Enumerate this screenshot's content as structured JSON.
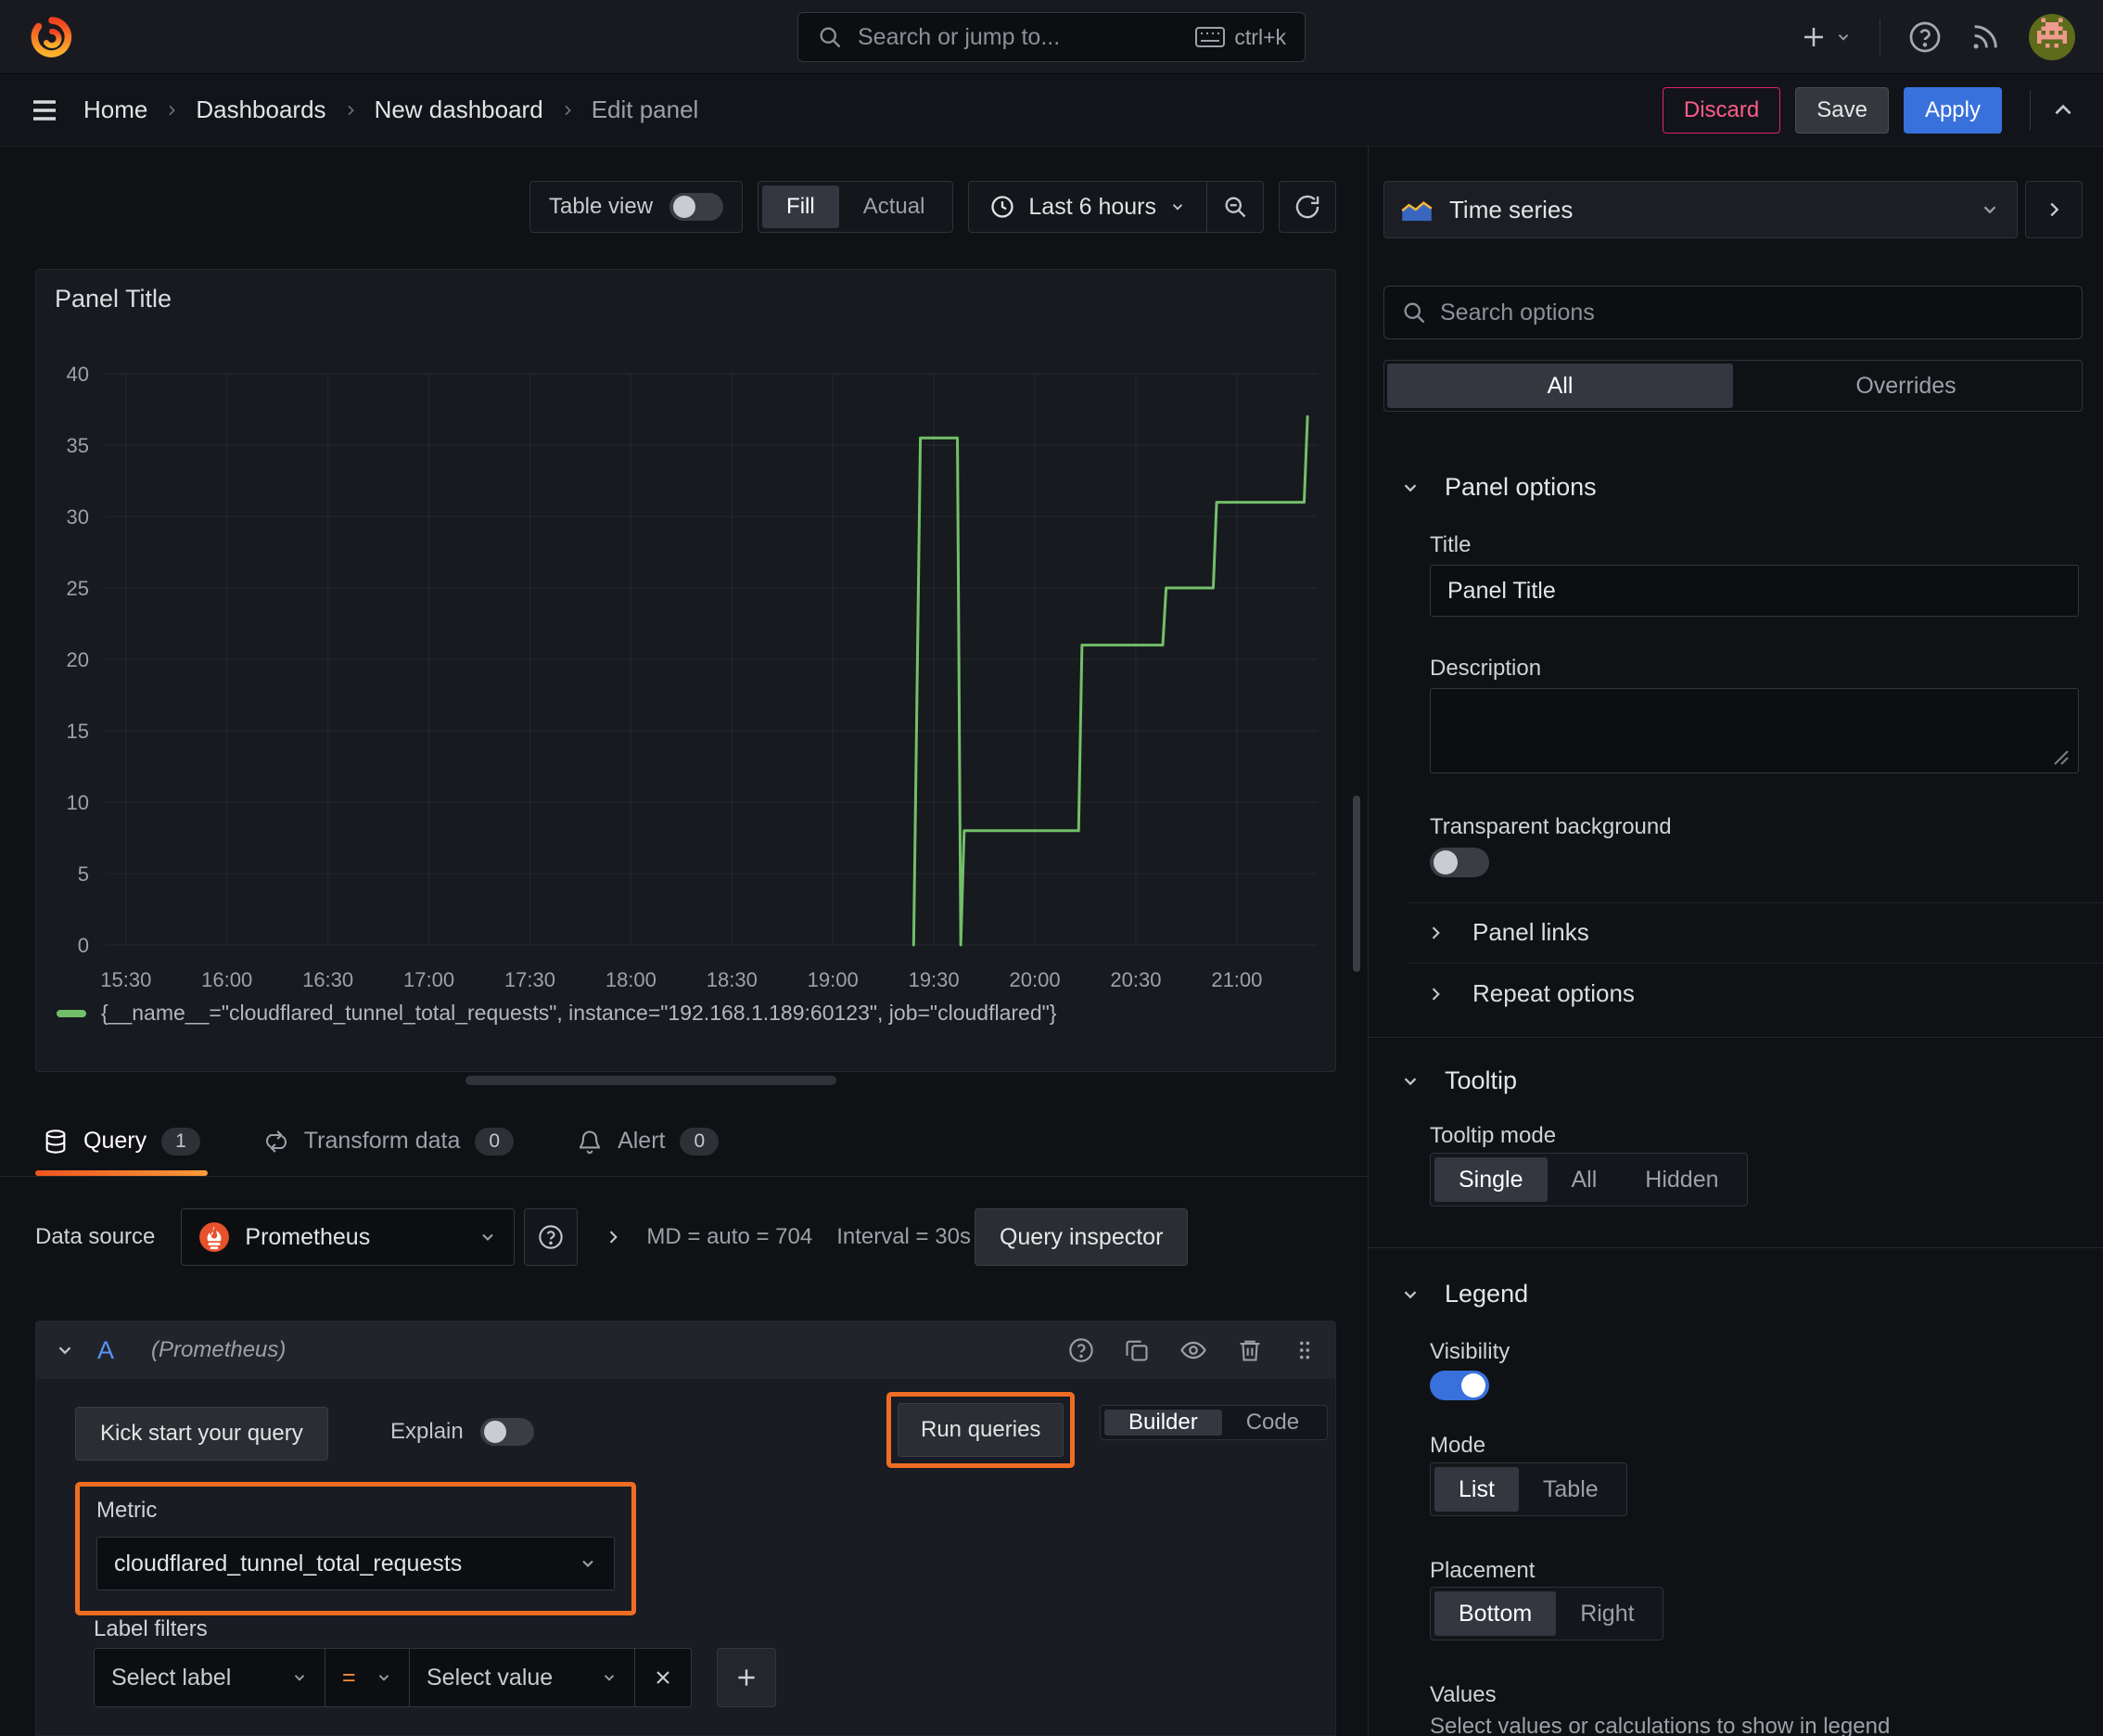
{
  "topnav": {
    "search_placeholder": "Search or jump to...",
    "shortcut": "ctrl+k"
  },
  "breadcrumbs": {
    "items": [
      "Home",
      "Dashboards",
      "New dashboard",
      "Edit panel"
    ]
  },
  "actions": {
    "discard": "Discard",
    "save": "Save",
    "apply": "Apply"
  },
  "toolbar": {
    "table_view": "Table view",
    "fill": "Fill",
    "actual": "Actual",
    "time_range": "Last 6 hours"
  },
  "panel": {
    "title": "Panel Title",
    "legend": "{__name__=\"cloudflared_tunnel_total_requests\", instance=\"192.168.1.189:60123\", job=\"cloudflared\"}"
  },
  "chart_data": {
    "type": "line",
    "title": "Panel Title",
    "xlabel": "",
    "ylabel": "",
    "grid": true,
    "legend_position": "bottom",
    "line_style": "stepped",
    "ylim": [
      0,
      40
    ],
    "y_ticks": [
      0,
      5,
      10,
      15,
      20,
      25,
      30,
      35,
      40
    ],
    "x_range": [
      "15:24",
      "21:24"
    ],
    "x_ticks": [
      "15:30",
      "16:00",
      "16:30",
      "17:00",
      "17:30",
      "18:00",
      "18:30",
      "19:00",
      "19:30",
      "20:00",
      "20:30",
      "21:00"
    ],
    "series": [
      {
        "name": "{__name__=\"cloudflared_tunnel_total_requests\", instance=\"192.168.1.189:60123\", job=\"cloudflared\"}",
        "color": "#73bf69",
        "points": [
          [
            "19:24",
            0
          ],
          [
            "19:26",
            35.5
          ],
          [
            "19:37",
            35.5
          ],
          [
            "19:38",
            0
          ],
          [
            "19:39",
            8
          ],
          [
            "20:13",
            8
          ],
          [
            "20:14",
            21
          ],
          [
            "20:38",
            21
          ],
          [
            "20:39",
            25
          ],
          [
            "20:53",
            25
          ],
          [
            "20:54",
            31
          ],
          [
            "21:20",
            31
          ],
          [
            "21:21",
            37
          ]
        ]
      }
    ]
  },
  "tabs": {
    "items": [
      {
        "label": "Query",
        "count": "1"
      },
      {
        "label": "Transform data",
        "count": "0"
      },
      {
        "label": "Alert",
        "count": "0"
      }
    ]
  },
  "datasource": {
    "label": "Data source",
    "name": "Prometheus",
    "md": "MD = auto = 704",
    "interval": "Interval = 30s",
    "inspector": "Query inspector"
  },
  "query": {
    "ref": "A",
    "hint": "(Prometheus)",
    "kick_start": "Kick start your query",
    "explain": "Explain",
    "run": "Run queries",
    "builder": "Builder",
    "code": "Code",
    "metric_label": "Metric",
    "metric_value": "cloudflared_tunnel_total_requests",
    "label_filters": "Label filters",
    "select_label": "Select label",
    "op": "=",
    "select_value": "Select value"
  },
  "viz": {
    "name": "Time series"
  },
  "options": {
    "search_placeholder": "Search options",
    "tab_all": "All",
    "tab_overrides": "Overrides",
    "panel_options": "Panel options",
    "title_label": "Title",
    "title_value": "Panel Title",
    "description": "Description",
    "transparent": "Transparent background",
    "panel_links": "Panel links",
    "repeat_options": "Repeat options",
    "tooltip": "Tooltip",
    "tooltip_mode": "Tooltip mode",
    "single": "Single",
    "all": "All",
    "hidden": "Hidden",
    "legend": "Legend",
    "visibility": "Visibility",
    "mode": "Mode",
    "list": "List",
    "table": "Table",
    "placement": "Placement",
    "bottom": "Bottom",
    "right": "Right",
    "values": "Values",
    "values_help": "Select values or calculations to show in legend"
  },
  "colors": {
    "accent_orange": "#ee6d23",
    "series_green": "#73bf69",
    "primary_blue": "#3871dc",
    "discard_red": "#e0226e"
  }
}
